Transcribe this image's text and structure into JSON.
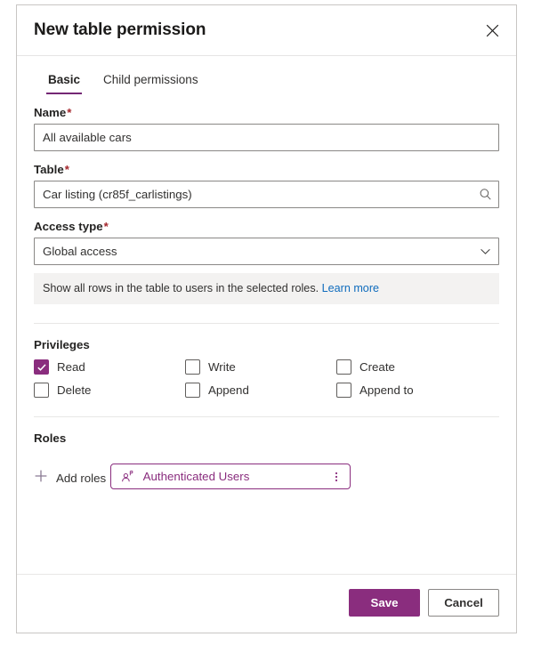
{
  "dialog": {
    "title": "New table permission",
    "close_icon": "close-icon"
  },
  "tabs": [
    {
      "label": "Basic",
      "active": true
    },
    {
      "label": "Child permissions",
      "active": false
    }
  ],
  "fields": {
    "name": {
      "label": "Name",
      "required_marker": "*",
      "value": "All available cars",
      "placeholder": ""
    },
    "table": {
      "label": "Table",
      "required_marker": "*",
      "value": "Car listing (cr85f_carlistings)",
      "placeholder": "",
      "icon": "search-icon"
    },
    "access_type": {
      "label": "Access type",
      "required_marker": "*",
      "value": "Global access",
      "icon": "chevron-down-icon",
      "info_text": "Show all rows in the table to users in the selected roles.",
      "info_link": "Learn more"
    }
  },
  "privileges": {
    "title": "Privileges",
    "items": [
      {
        "label": "Read",
        "checked": true
      },
      {
        "label": "Write",
        "checked": false
      },
      {
        "label": "Create",
        "checked": false
      },
      {
        "label": "Delete",
        "checked": false
      },
      {
        "label": "Append",
        "checked": false
      },
      {
        "label": "Append to",
        "checked": false
      }
    ]
  },
  "roles": {
    "title": "Roles",
    "add_label": "Add roles",
    "add_icon": "plus-icon",
    "chips": [
      {
        "label": "Authenticated Users",
        "icon": "person-contact-icon",
        "menu_icon": "more-vertical-icon"
      }
    ]
  },
  "footer": {
    "save_label": "Save",
    "cancel_label": "Cancel"
  },
  "colors": {
    "accent": "#8a2d7e",
    "tab_underline": "#742774",
    "link": "#0f6cbd",
    "required": "#a4262c",
    "info_bg": "#f3f2f1",
    "border": "#8a8886"
  }
}
